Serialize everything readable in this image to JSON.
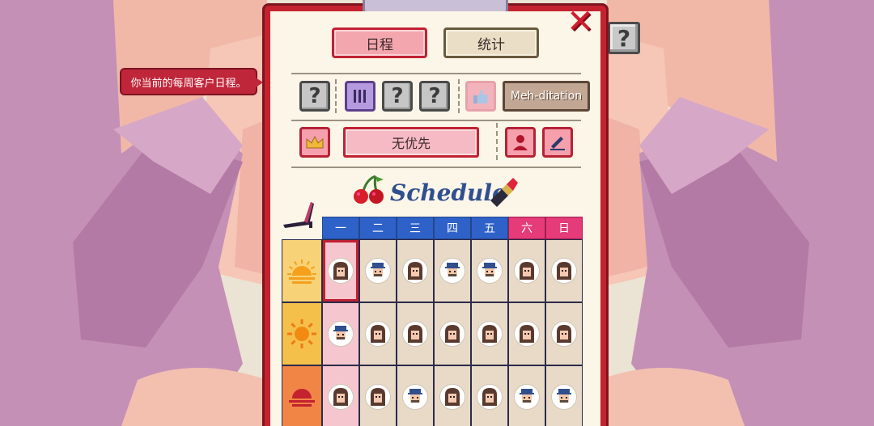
{
  "tooltip": {
    "text": "你当前的每周客户日程。"
  },
  "help_button": {
    "label": "?"
  },
  "close_button": {
    "label": "✕"
  },
  "tabs": [
    {
      "label": "日程",
      "active": true
    },
    {
      "label": "统计",
      "active": false
    }
  ],
  "filters": {
    "unknown_label": "?",
    "meditation_label": "Meh-ditation",
    "priority_label": "无优先"
  },
  "schedule": {
    "title": "Schedule",
    "days": [
      "一",
      "二",
      "三",
      "四",
      "五",
      "六",
      "日"
    ],
    "slots": [
      {
        "name": "morning",
        "color": "#f8d277",
        "clients": [
          "girl",
          "man",
          "girl",
          "man",
          "man",
          "girl",
          "girl"
        ]
      },
      {
        "name": "afternoon",
        "color": "#f5c04a",
        "clients": [
          "man",
          "girl",
          "girl",
          "girl",
          "girl",
          "girl",
          "girl"
        ]
      },
      {
        "name": "evening",
        "color": "#f08546",
        "clients": [
          "girl",
          "girl",
          "man",
          "girl",
          "girl",
          "man",
          "man"
        ]
      }
    ]
  },
  "colors": {
    "board_red": "#c4222f",
    "paper": "#fbf6e8",
    "weekday_header": "#2f62c8",
    "weekend_header": "#e53b78"
  }
}
